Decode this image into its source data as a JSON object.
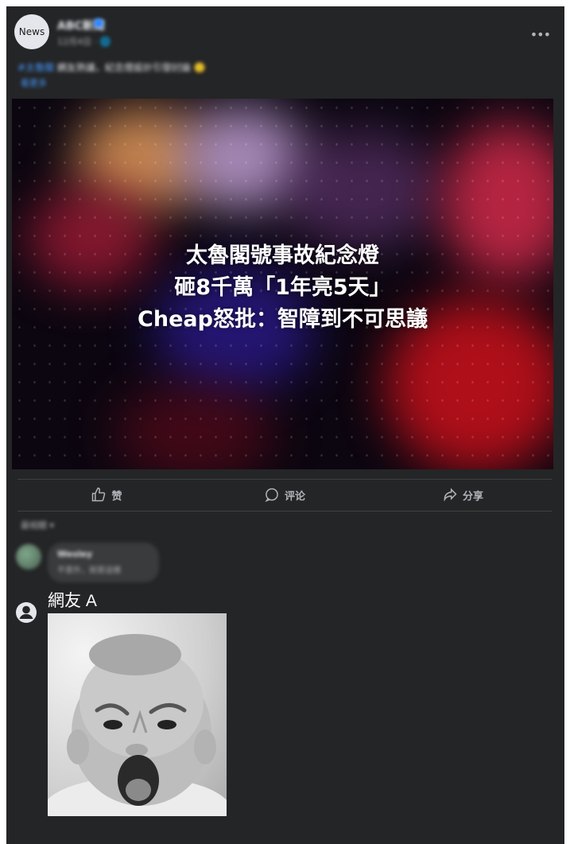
{
  "post": {
    "avatar_text": "News",
    "page_name": "ABC新聞",
    "meta": "12月4日 · 🌐",
    "more_icon": "more-icon",
    "caption_tag": "#太魯閣",
    "caption": " 網友熱議，紀念燈設計引發討論 🙂",
    "caption_link": "看更多"
  },
  "hero": {
    "line1": "太魯閣號事故紀念燈",
    "line2": "砸8千萬「1年亮5天」",
    "line3": "Cheap怒批：智障到不可思議"
  },
  "actions": [
    {
      "label": "赞",
      "icon": "thumbs-up-icon"
    },
    {
      "label": "评论",
      "icon": "comment-icon"
    },
    {
      "label": "分享",
      "icon": "share-icon"
    }
  ],
  "comments": {
    "sort_label": "最相關 ▾",
    "first": {
      "name": "Wesley",
      "text": "不意外，就是這樣"
    },
    "user": {
      "name": "網友 A",
      "icon": "user-avatar-icon",
      "image": "angry-baby-image"
    }
  },
  "colors": {
    "card": "#242526",
    "text_secondary": "#b0b3b8",
    "link": "#4599ff"
  }
}
